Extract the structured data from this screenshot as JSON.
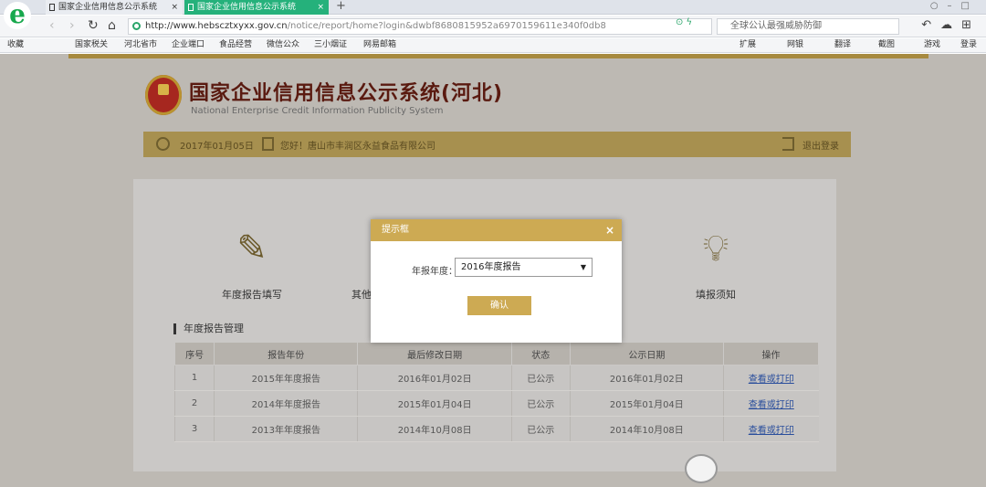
{
  "browser": {
    "tabs": [
      {
        "label": "国家企业信用信息公示系统"
      },
      {
        "label": "国家企业信用信息公示系统"
      }
    ],
    "url_host": "http://www.hebscztxyxx.gov.cn",
    "url_path": "/notice/report/home?login&dwbf8680815952a6970159611e340f0db8",
    "search_text": "全球公认最强威胁防御",
    "bookmarks": [
      "收藏",
      "国家税关",
      "河北省市",
      "企业端口",
      "食品经营",
      "微信公众",
      "三小烟证",
      "网易邮箱"
    ],
    "right_bookmarks": [
      "扩展",
      "网银",
      "翻译",
      "截图",
      "游戏",
      "登录"
    ]
  },
  "site": {
    "title": "国家企业信用信息公示系统(河北)",
    "subtitle": "National Enterprise Credit Information Publicity System",
    "date": "2017年01月05日",
    "welcome": "您好！唐山市丰润区永益食品有限公司",
    "logout": "退出登录"
  },
  "functions": [
    {
      "label": "年度报告填写",
      "icon": "edit-icon"
    },
    {
      "label": "其他",
      "icon": "info-icon"
    },
    {
      "label": "填报须知",
      "icon": "lightbulb-icon"
    }
  ],
  "section_title": "年度报告管理",
  "table": {
    "headers": [
      "序号",
      "报告年份",
      "最后修改日期",
      "状态",
      "公示日期",
      "操作"
    ],
    "rows": [
      [
        "1",
        "2015年年度报告",
        "2016年01月02日",
        "已公示",
        "2016年01月02日",
        "查看或打印"
      ],
      [
        "2",
        "2014年年度报告",
        "2015年01月04日",
        "已公示",
        "2015年01月04日",
        "查看或打印"
      ],
      [
        "3",
        "2013年年度报告",
        "2014年10月08日",
        "已公示",
        "2014年10月08日",
        "查看或打印"
      ]
    ]
  },
  "modal": {
    "title": "提示框",
    "close": "×",
    "field_label": "年报年度：",
    "selected": "2016年度报告",
    "ok": "确认"
  }
}
